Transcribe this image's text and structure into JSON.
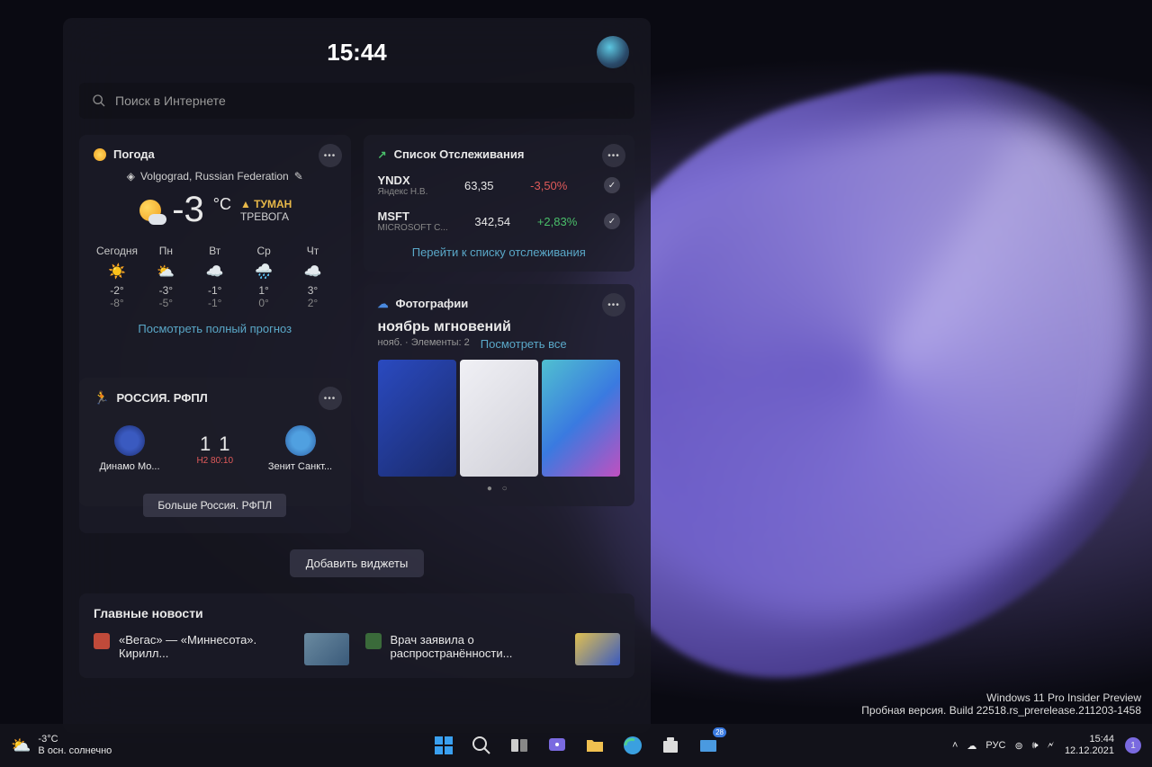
{
  "panel": {
    "time": "15:44",
    "search_placeholder": "Поиск в Интернете"
  },
  "weather": {
    "title": "Погода",
    "location": "Volgograd, Russian Federation",
    "temp": "-3",
    "unit": "°C",
    "alert_prefix": "▲ ТУМАН",
    "alert_sub": "ТРЕВОГА",
    "forecast": [
      {
        "day": "Сегодня",
        "icon": "☀️",
        "hi": "-2°",
        "lo": "-8°"
      },
      {
        "day": "Пн",
        "icon": "⛅",
        "hi": "-3°",
        "lo": "-5°"
      },
      {
        "day": "Вт",
        "icon": "☁️",
        "hi": "-1°",
        "lo": "-1°"
      },
      {
        "day": "Ср",
        "icon": "🌧️",
        "hi": "1°",
        "lo": "0°"
      },
      {
        "day": "Чт",
        "icon": "☁️",
        "hi": "3°",
        "lo": "2°"
      }
    ],
    "link": "Посмотреть полный прогноз"
  },
  "stocks": {
    "title": "Список Отслеживания",
    "rows": [
      {
        "sym": "YNDX",
        "name": "Яндекс Н.В.",
        "price": "63,35",
        "change": "-3,50%",
        "dir": "neg"
      },
      {
        "sym": "MSFT",
        "name": "MICROSOFT C...",
        "price": "342,54",
        "change": "+2,83%",
        "dir": "pos"
      }
    ],
    "link": "Перейти к списку отслеживания"
  },
  "sports": {
    "title": "РОССИЯ. РФПЛ",
    "team1": "Динамо Мо...",
    "team2": "Зенит Санкт...",
    "score1": "1",
    "score2": "1",
    "meta": "H2 80:10",
    "more": "Больше Россия. РФПЛ"
  },
  "photos": {
    "title": "Фотографии",
    "album": "ноябрь мгновений",
    "sub": "нояб. · Элементы: 2",
    "see_all": "Посмотреть все"
  },
  "add_widgets": "Добавить виджеты",
  "news": {
    "title": "Главные новости",
    "items": [
      {
        "text": "«Вегас» — «Миннесота». Кирилл..."
      },
      {
        "text": "Врач заявила о распространённости..."
      }
    ]
  },
  "build": {
    "line1": "Windows 11 Pro Insider Preview",
    "line2": "Пробная версия. Build 22518.rs_prerelease.211203-1458"
  },
  "taskbar": {
    "weather_temp": "-3°C",
    "weather_desc": "В осн. солнечно",
    "lang": "РУС",
    "time": "15:44",
    "date": "12.12.2021",
    "notif_count": "1",
    "store_badge": "28"
  }
}
